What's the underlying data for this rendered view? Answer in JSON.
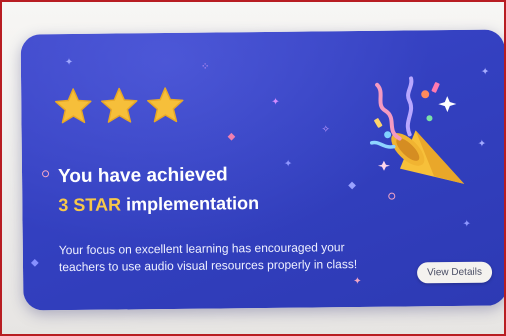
{
  "achievement_card": {
    "star_count": 3,
    "star_rating": "3 of 3",
    "title_prefix": "You have achieved",
    "title_highlight": "3 STAR",
    "title_suffix": " implementation",
    "message": "Your focus on excellent learning has encouraged your teachers to use audio visual resources properly in class!",
    "view_details_label": "View Details"
  },
  "colors": {
    "card_background": "#3340c0",
    "star_fill": "#f6bf3a",
    "highlight_text": "#f7c84a",
    "title_text": "#ffffff",
    "button_background": "#f4f2ef",
    "frame_border": "#b81d22"
  },
  "icons": {
    "stars": "star-icon",
    "celebration": "party-popper-icon"
  }
}
